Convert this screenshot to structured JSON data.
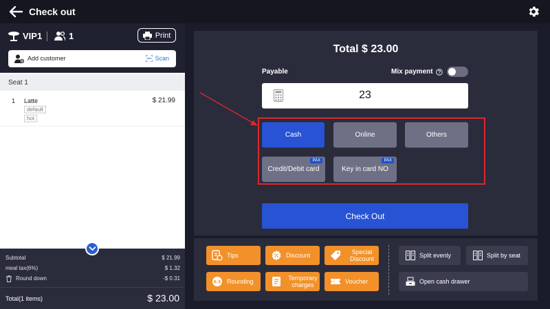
{
  "header": {
    "title": "Check out"
  },
  "order": {
    "table_name": "VIP1",
    "guests": "1",
    "print_label": "Print",
    "add_customer_label": "Add customer",
    "scan_label": "Scan",
    "seat_label": "Seat 1",
    "items": [
      {
        "qty": "1",
        "name": "Latte",
        "price": "$ 21.99",
        "modifiers": [
          "default",
          "hot"
        ]
      }
    ],
    "summary": {
      "subtotal_label": "Subtotal",
      "subtotal": "$ 21.99",
      "tax_label": "meal tax(6%)",
      "tax": "$ 1.32",
      "round_label": "Round down",
      "round": "-$ 0.31",
      "total_label": "Total(1 items)",
      "total": "$ 23.00"
    }
  },
  "payment": {
    "total_title": "Total $ 23.00",
    "payable_label": "Payable",
    "mix_payment_label": "Mix payment",
    "mix_payment_on": false,
    "amount": "23",
    "methods": [
      "Cash",
      "Online",
      "Others",
      "Credit/Debit card",
      "Key in card NO"
    ],
    "selected_method": "Cash",
    "pax_badge": "PAX",
    "checkout_label": "Check Out"
  },
  "actions": {
    "tips": "Tips",
    "discount": "Discount",
    "special_discount": "Special Discount",
    "rounding": "Rounding",
    "temporary_charges": "Temporary charges",
    "voucher": "Voucher",
    "split_evenly": "Split evenly",
    "split_by_seat": "Split by seat",
    "open_cash_drawer": "Open cash drawer"
  },
  "colors": {
    "accent": "#2753d4",
    "action_orange": "#f2912a",
    "highlight_red": "#e0262b",
    "panel": "#2a2c3c",
    "background": "#1a1c2b"
  }
}
